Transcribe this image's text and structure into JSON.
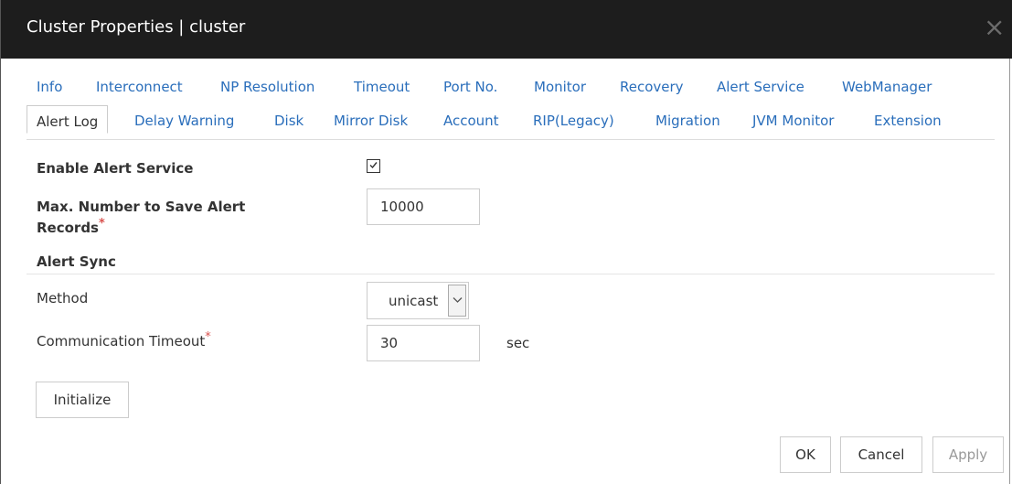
{
  "dialog": {
    "title": "Cluster Properties | cluster",
    "close_glyph": "×"
  },
  "tabs_row1": [
    "Info",
    "Interconnect",
    "NP Resolution",
    "Timeout",
    "Port No.",
    "Monitor",
    "Recovery",
    "Alert Service",
    "WebManager"
  ],
  "tabs_row2": [
    "Alert Log",
    "Delay Warning",
    "Disk",
    "Mirror Disk",
    "Account",
    "RIP(Legacy)",
    "Migration",
    "JVM Monitor",
    "Extension"
  ],
  "active_tab": "Alert Log",
  "form": {
    "enable_alert_service_label": "Enable Alert Service",
    "enable_alert_service_checked": true,
    "max_records_label_line1": "Max. Number to Save Alert",
    "max_records_label_line2": "Records",
    "max_records_value": "10000",
    "alert_sync_heading": "Alert Sync",
    "method_label": "Method",
    "method_value": "unicast",
    "comm_timeout_label": "Communication Timeout",
    "comm_timeout_value": "30",
    "comm_timeout_unit": "sec",
    "required_marker": "*"
  },
  "buttons": {
    "initialize": "Initialize",
    "ok": "OK",
    "cancel": "Cancel",
    "apply": "Apply"
  },
  "colors": {
    "titlebar_bg": "#1d1d1d",
    "link": "#2a6ebb",
    "required": "#d9534f"
  }
}
